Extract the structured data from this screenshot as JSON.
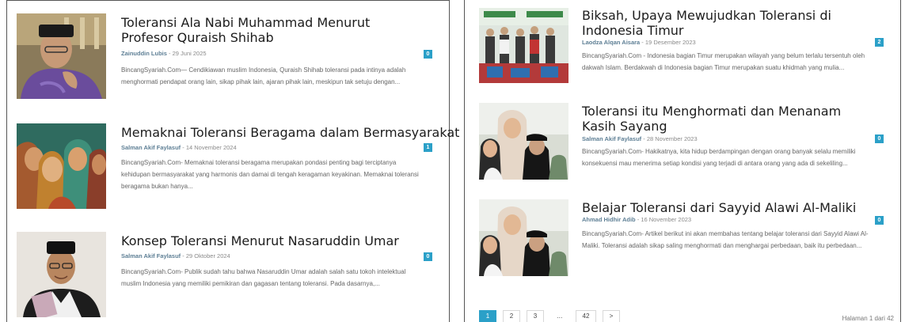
{
  "left_articles": [
    {
      "title": "Toleransi Ala Nabi Muhammad Menurut Profesor Quraish Shihab",
      "author": "Zainuddin Lubis",
      "date": "29 Juni 2025",
      "comments": "0",
      "excerpt": "BincangSyariah.Com— Cendikiawan muslim Indonesia, Quraish Shihab toleransi pada intinya adalah menghormati pendapat orang lain, sikap pihak lain, ajaran pihak lain, meskipun tak setuju dengan..."
    },
    {
      "title": "Memaknai Toleransi Beragama dalam Bermasyarakat",
      "author": "Salman Akif Faylasuf",
      "date": "14 November 2024",
      "comments": "1",
      "excerpt": "BincangSyariah.Com- Memaknai toleransi beragama merupakan pondasi penting bagi terciptanya kehidupan bermasyarakat yang harmonis dan damai di tengah keragaman keyakinan. Memaknai toleransi beragama bukan hanya..."
    },
    {
      "title": "Konsep Toleransi Menurut Nasaruddin Umar",
      "author": "Salman Akif Faylasuf",
      "date": "29 Oktober 2024",
      "comments": "0",
      "excerpt": "BincangSyariah.Com- Publik sudah tahu bahwa Nasaruddin Umar adalah salah satu tokoh intelektual muslim Indonesia yang memiliki pemikiran dan gagasan tentang toleransi. Pada dasarnya,..."
    }
  ],
  "right_articles": [
    {
      "title": "Biksah, Upaya Mewujudkan Toleransi di Indonesia Timur",
      "author": "Laodza Alqan Aisara",
      "date": "19 Desember 2023",
      "comments": "2",
      "excerpt": "BincangSyariah.Com - Indonesia bagian Timur merupakan wilayah yang belum terlalu tersentuh oleh dakwah Islam. Berdakwah di Indonesia bagian Timur merupakan suatu khidmah yang mulia..."
    },
    {
      "title": "Toleransi itu Menghormati dan Menanam Kasih Sayang",
      "author": "Salman Akif Faylasuf",
      "date": "28 November 2023",
      "comments": "0",
      "excerpt": "BincangSyariah.Com- Hakikatnya, kita hidup berdampingan dengan orang banyak selalu memiliki konsekuensi mau menerima setiap kondisi yang terjadi di antara orang yang ada di sekeliling..."
    },
    {
      "title": "Belajar Toleransi dari Sayyid Alawi Al-Maliki",
      "author": "Ahmad Hidhir Adib",
      "date": "16 November 2023",
      "comments": "0",
      "excerpt": "BincangSyariah.Com- Artikel berikut ini akan membahas tentang belajar toleransi dari Sayyid Alawi Al-Maliki. Toleransi adalah sikap saling menghormati dan menghargai perbedaan, baik itu perbedaan..."
    }
  ],
  "meta_separator": " - ",
  "pagination": {
    "pages": [
      "1",
      "2",
      "3"
    ],
    "dots": "...",
    "last": "42",
    "next": ">",
    "info": "Halaman 1 dari 42"
  },
  "colors": {
    "accent": "#2ba0c8",
    "author": "#5e7f95"
  }
}
